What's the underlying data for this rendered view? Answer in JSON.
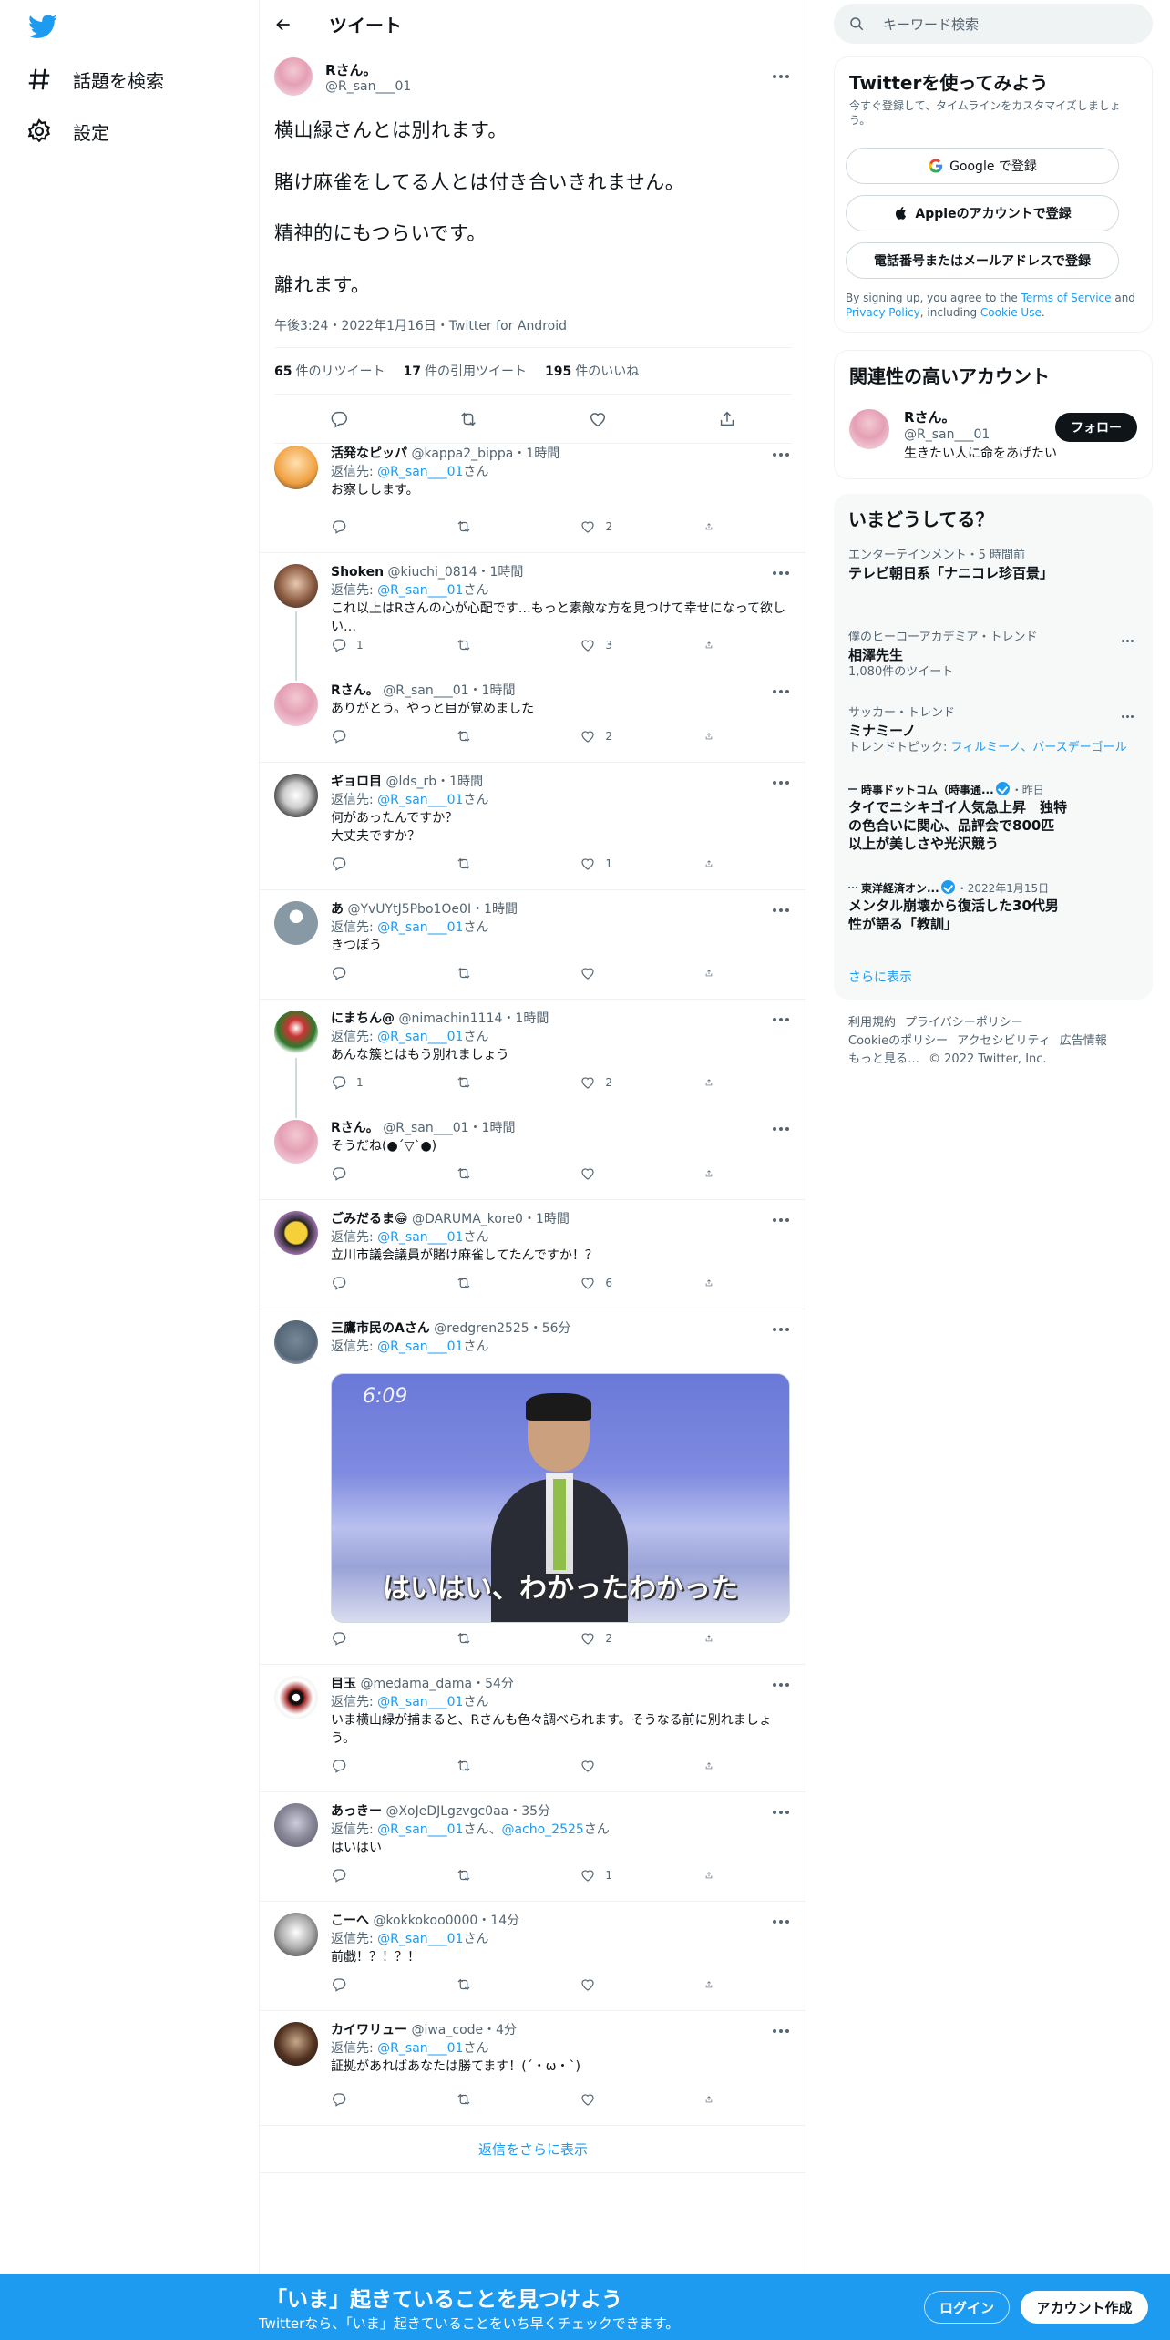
{
  "nav": {
    "explore": "話題を検索",
    "settings": "設定"
  },
  "header": {
    "title": "ツイート"
  },
  "tweet": {
    "name": "Rさん。",
    "handle": "@R_san___01",
    "lines": [
      "横山緑さんとは別れます。",
      "賭け麻雀をしてる人とは付き合いきれません。",
      "精神的にもつらいです。",
      "離れます。"
    ],
    "meta": "午後3:24・2022年1月16日・Twitter for Android",
    "retweets": "65",
    "retweets_label": "件のリツイート",
    "quotes": "17",
    "quotes_label": "件の引用ツイート",
    "likes": "195",
    "likes_label": "件のいいね"
  },
  "reply_to_label": "返信先:",
  "san": "さん",
  "replies": [
    {
      "name": "活発なピッパ",
      "handle": "@kappa2_bippa",
      "time": "・1時間",
      "to": "@R_san___01",
      "text": "お察しします。",
      "r": "",
      "rt": "",
      "l": "2"
    },
    {
      "name": "Shoken",
      "handle": "@kiuchi_0814",
      "time": "・1時間",
      "to": "@R_san___01",
      "text": "これ以上はRさんの心が心配です…もっと素敵な方を見つけて幸せになって欲しい…",
      "r": "1",
      "rt": "",
      "l": "3"
    },
    {
      "name": "Rさん。",
      "handle": "@R_san___01",
      "time": "・1時間",
      "to": "",
      "text": "ありがとう。やっと目が覚めました",
      "r": "",
      "rt": "",
      "l": "2"
    },
    {
      "name": "ギョロ目",
      "handle": "@lds_rb",
      "time": "・1時間",
      "to": "@R_san___01",
      "text": "何があったんですか？\n大丈夫ですか？",
      "r": "",
      "rt": "",
      "l": "1"
    },
    {
      "name": "あ",
      "handle": "@YvUYtJ5Pbo1Oe0I",
      "time": "・1時間",
      "to": "@R_san___01",
      "text": "きつぽう",
      "r": "",
      "rt": "",
      "l": ""
    },
    {
      "name": "にまちん@",
      "handle": "@nimachin1114",
      "time": "・1時間",
      "to": "@R_san___01",
      "text": "あんな簇とはもう別れましょう",
      "r": "1",
      "rt": "",
      "l": "2"
    },
    {
      "name": "Rさん。",
      "handle": "@R_san___01",
      "time": "・1時間",
      "to": "",
      "text": "そうだね(●´▽`●)",
      "r": "",
      "rt": "",
      "l": ""
    },
    {
      "name": "ごみだるま😁",
      "handle": "@DARUMA_kore0",
      "time": "・1時間",
      "to": "@R_san___01",
      "text": "立川市議会議員が賭け麻雀してたんですか！？",
      "r": "",
      "rt": "",
      "l": "6"
    },
    {
      "name": "三鷹市民のAさん",
      "handle": "@redgren2525",
      "time": "・56分",
      "to": "@R_san___01",
      "text": "",
      "r": "",
      "rt": "",
      "l": "2",
      "media_time": "6:09",
      "media_caption": "はいはい、わかったわかった"
    },
    {
      "name": "目玉",
      "handle": "@medama_dama",
      "time": "・54分",
      "to": "@R_san___01",
      "text": "いま横山緑が捕まると、Rさんも色々調べられます。そうなる前に別れましょう。",
      "r": "",
      "rt": "",
      "l": ""
    },
    {
      "name": "あっきー",
      "handle": "@XoJeDJLgzvgc0aa",
      "time": "・35分",
      "to": "@R_san___01",
      "to2": "@acho_2525",
      "text": "はいはい",
      "r": "",
      "rt": "",
      "l": "1"
    },
    {
      "name": "こーへ",
      "handle": "@kokkokoo0000",
      "time": "・14分",
      "to": "@R_san___01",
      "text": "前戯！？！？！",
      "r": "",
      "rt": "",
      "l": ""
    },
    {
      "name": "カイワリュー",
      "handle": "@iwa_code",
      "time": "・4分",
      "to": "@R_san___01",
      "text": "証拠があればあなたは勝てます！(´・ω・`)",
      "r": "",
      "rt": "",
      "l": ""
    }
  ],
  "show_more_replies": "返信をさらに表示",
  "search": {
    "placeholder": "キーワード検索"
  },
  "signup": {
    "title": "Twitterを使ってみよう",
    "sub": "今すぐ登録して、タイムラインをカスタマイズしましょう。",
    "google": "Google で登録",
    "apple": "Appleのアカウントで登録",
    "phone": "電話番号またはメールアドレスで登録",
    "terms_pre": "By signing up, you agree to the ",
    "tos": "Terms of Service",
    "and": " and ",
    "privacy": "Privacy Policy",
    "including": ", including ",
    "cookie": "Cookie Use",
    "period": "."
  },
  "related": {
    "title": "関連性の高いアカウント",
    "name": "Rさん。",
    "handle": "@R_san___01",
    "bio": "生きたい人に命をあげたい",
    "follow": "フォロー"
  },
  "trends": {
    "title": "いまどうしてる？",
    "items": [
      {
        "context": "エンターテインメント・5 時間前",
        "title": "テレビ朝日系「ナニコレ珍百景」"
      },
      {
        "context": "僕のヒーローアカデミア・トレンド",
        "title": "相澤先生",
        "sub": "1,080件のツイート"
      },
      {
        "context": "サッカー・トレンド",
        "title": "ミナミーノ",
        "sub_pre": "トレンドトピック: ",
        "links": "フィルミーノ、バースデーゴール"
      },
      {
        "source": "時事ドットコム（時事通...",
        "when": "・昨日",
        "title": "タイでニシキゴイ人気急上昇　独特の色合いに関心、品評会で800匹以上が美しさや光沢競う"
      },
      {
        "source": "東洋経済オン...",
        "when": "・2022年1月15日",
        "title": "メンタル崩壊から復活した30代男性が語る「教訓」"
      }
    ],
    "show_more": "さらに表示"
  },
  "footer": {
    "terms": "利用規約",
    "privacy": "プライバシーポリシー",
    "cookie": "Cookieのポリシー",
    "accessibility": "アクセシビリティ",
    "ads": "広告情報",
    "more": "もっと見る…",
    "copyright": "© 2022 Twitter, Inc."
  },
  "banner": {
    "heading": "「いま」起きていることを見つけよう",
    "sub": "Twitterなら、「いま」起きていることをいち早くチェックできます。",
    "login": "ログイン",
    "signup": "アカウント作成"
  },
  "colors": {
    "accent": "#1d9bf0",
    "text": "#0f1419",
    "muted": "#536471",
    "border": "#eff3f4"
  }
}
